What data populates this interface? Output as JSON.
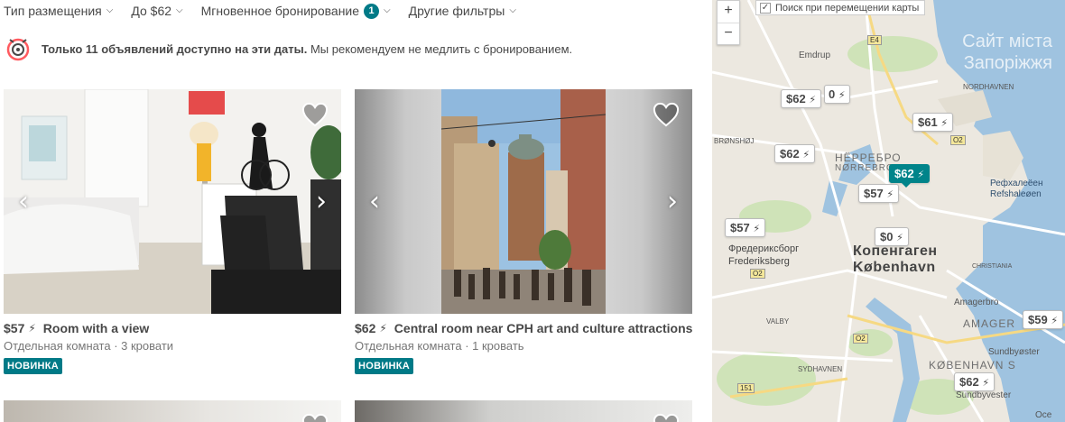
{
  "filters": [
    {
      "label": "Тип размещения"
    },
    {
      "label": "До $62"
    },
    {
      "label": "Мгновенное бронирование",
      "badge": "1"
    },
    {
      "label": "Другие фильтры"
    }
  ],
  "notice": {
    "bold": "Только 11 объявлений доступно на эти даты.",
    "text": "Мы рекомендуем не медлить с бронированием."
  },
  "listings": [
    {
      "price": "$57",
      "title": "Room with a view",
      "subtitle": "Отдельная комната · 3 кровати",
      "badge": "НОВИНКА"
    },
    {
      "price": "$62",
      "title": "Central room near CPH art and culture attractions",
      "subtitle": "Отдельная комната · 1 кровать",
      "badge": "НОВИНКА"
    }
  ],
  "map": {
    "search_toggle": "Поиск при перемещении карты",
    "zoom_in": "+",
    "zoom_out": "−",
    "checkmark": "✓",
    "watermark_line1": "Сайт міста",
    "watermark_line2": "Запоріжжя",
    "pins": [
      {
        "label": "$62",
        "active": false
      },
      {
        "label": "0",
        "active": false
      },
      {
        "label": "$61",
        "active": false
      },
      {
        "label": "$62",
        "active": false
      },
      {
        "label": "$62",
        "active": true
      },
      {
        "label": "$57",
        "active": false
      },
      {
        "label": "$57",
        "active": false
      },
      {
        "label": "$0",
        "active": false
      },
      {
        "label": "$59",
        "active": false
      },
      {
        "label": "$62",
        "active": false
      }
    ],
    "labels": {
      "emdrup": "Emdrup",
      "nordhavnen": "NORDHAVNEN",
      "norrebro_ru": "НЁРРЕБРО",
      "norrebro": "NØRREBRO",
      "frederiksberg_ru": "Фредериксборг",
      "frederiksberg": "Frederiksberg",
      "copenhagen_ru": "Копенгаген",
      "copenhagen": "København",
      "refshaleoen_ru": "Рефхалеёен",
      "refshaleoen": "Refshaleøen",
      "amager": "AMAGER",
      "amagerbro": "Amagerbro",
      "kobenhavn_s": "KØBENHAVN S",
      "sundbyoster": "Sundbyøster",
      "sundbyvester": "Sundbyvester",
      "valby": "VALBY",
      "sydhavnen": "SYDHAVNEN",
      "christiania": "CHRISTIANIA",
      "bronshoj": "BRØNSHØJ",
      "osc": "Oce"
    },
    "roads": [
      "E4",
      "O2",
      "O2",
      "O2",
      "151"
    ]
  },
  "colors": {
    "accent": "#007a87",
    "pin_active": "#00848a",
    "water": "#9fc3e0",
    "park": "#cfe3b8"
  },
  "icons": {
    "heart": "heart-icon",
    "bolt": "⚡",
    "left": "‹",
    "right": "›"
  }
}
